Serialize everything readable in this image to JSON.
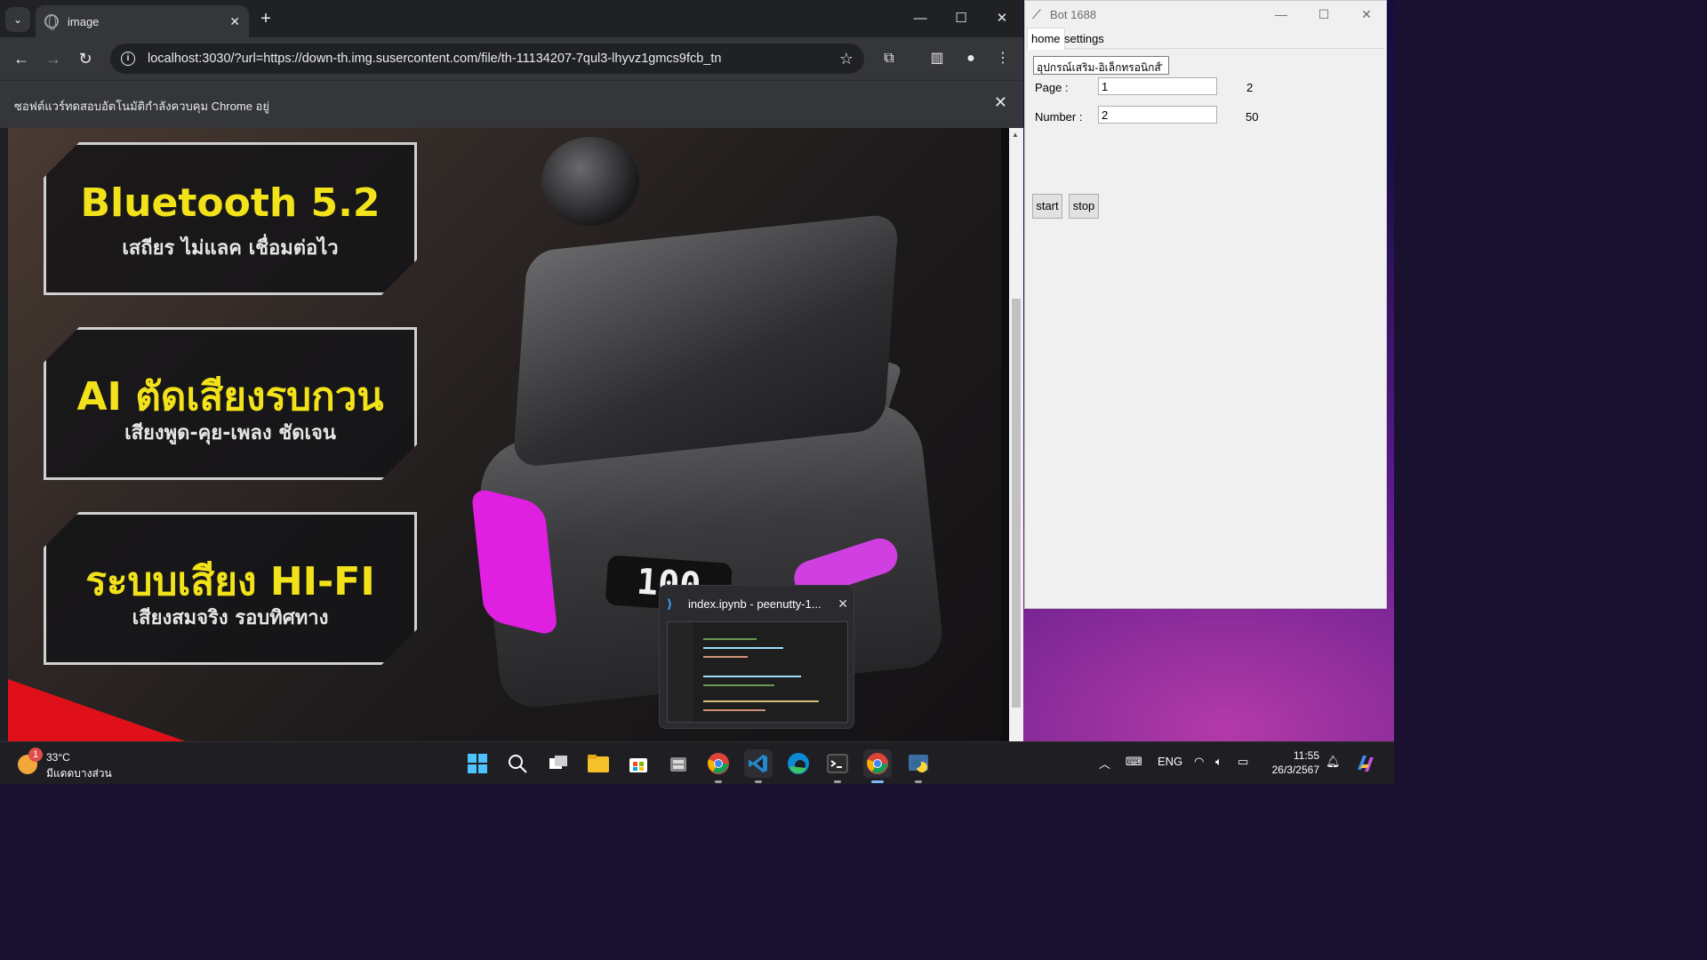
{
  "chrome": {
    "tab_title": "image",
    "url": "localhost:3030/?url=https://down-th.img.susercontent.com/file/th-11134207-7qul3-lhyvz1gmcs9fcb_tn",
    "infobar_message": "ซอฟต์แวร์ทดสอบอัตโนมัติกำลังควบคุม Chrome อยู่",
    "icons": [
      "tab-search-icon",
      "globe-icon",
      "close-icon",
      "new-tab-icon",
      "minimize-icon",
      "maximize-icon",
      "back-icon",
      "forward-icon",
      "reload-icon",
      "site-info-icon",
      "bookmark-star-icon",
      "extensions-icon",
      "side-panel-icon",
      "profile-icon",
      "menu-icon"
    ]
  },
  "product_image": {
    "badges": [
      {
        "big": "Bluetooth 5.2",
        "small": "เสถียร ไม่แลค เชื่อมต่อไว"
      },
      {
        "big": "AI ตัดเสียงรบกวน",
        "small": "เสียงพูด-คุย-เพลง ชัดเจน"
      },
      {
        "big": "ระบบเสียง HI-FI",
        "small": "เสียงสมจริง รอบทิศทาง"
      }
    ],
    "case_display": "100",
    "accent_color": "#f2e21a",
    "glow_color": "#e020e0"
  },
  "vscode_preview": {
    "title": "index.ipynb - peenutty-1..."
  },
  "bot_window": {
    "title": "Bot 1688",
    "tabs": [
      "home",
      "settings"
    ],
    "category_select": "อุปกรณ์เสริม-อิเล็กทรอนิกส์",
    "page_label": "Page :",
    "page_value": "1",
    "page_max": "2",
    "number_label": "Number :",
    "number_value": "2",
    "number_max": "50",
    "start_label": "start",
    "stop_label": "stop"
  },
  "taskbar": {
    "weather_temp": "33°C",
    "weather_condition": "มีแดดบางส่วน",
    "weather_alert_count": "1",
    "language": "ENG",
    "time": "11:55",
    "date": "26/3/2567",
    "apps": [
      "start-icon",
      "search-icon",
      "task-view-icon",
      "file-explorer-icon",
      "microsoft-store-icon",
      "file-cabinet-icon",
      "chrome-icon",
      "vscode-icon",
      "edge-icon",
      "terminal-icon",
      "chrome-icon",
      "python-icon"
    ]
  }
}
